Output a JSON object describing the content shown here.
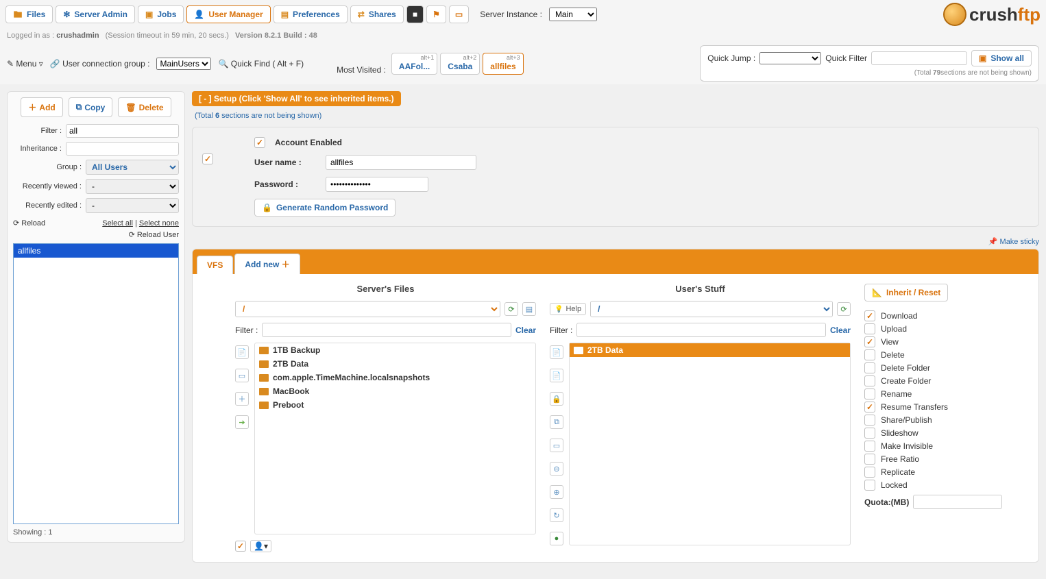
{
  "topnav": {
    "files": "Files",
    "server_admin": "Server Admin",
    "jobs": "Jobs",
    "user_manager": "User Manager",
    "preferences": "Preferences",
    "shares": "Shares",
    "server_instance_label": "Server Instance :",
    "server_instance_value": "Main"
  },
  "logo": {
    "part1": "crush",
    "part2": "ftp"
  },
  "info": {
    "logged_in_as_label": "Logged in as :",
    "user": "crushadmin",
    "timeout": "(Session timeout in 59 min, 20 secs.)",
    "version": "Version 8.2.1 Build : 48"
  },
  "toolbar2": {
    "menu": "Menu",
    "conn_group_label": "User connection group :",
    "conn_group_value": "MainUsers",
    "quick_find": "Quick Find ( Alt + F)",
    "most_visited": "Most Visited :",
    "tabs": [
      {
        "alt": "alt+1",
        "label": "AAFol..."
      },
      {
        "alt": "alt+2",
        "label": "Csaba"
      },
      {
        "alt": "alt+3",
        "label": "allfiles"
      }
    ],
    "quick_jump": "Quick Jump :",
    "quick_filter": "Quick Filter",
    "show_all": "Show all",
    "note_a": "(Total ",
    "note_b": "79",
    "note_c": "sections are not being shown)"
  },
  "sidebar": {
    "add": "Add",
    "copy": "Copy",
    "delete": "Delete",
    "filter_label": "Filter :",
    "filter_value": "all",
    "inheritance_label": "Inheritance :",
    "group_label": "Group :",
    "group_value": "All Users",
    "recently_viewed": "Recently viewed :",
    "recently_viewed_value": "-",
    "recently_edited": "Recently edited :",
    "recently_edited_value": "-",
    "reload": "Reload",
    "select_all": "Select all",
    "select_none": "Select none",
    "reload_user": "Reload User",
    "users": [
      "allfiles"
    ],
    "showing_label": "Showing :",
    "showing_count": "1"
  },
  "setup": {
    "header": "[ - ] Setup (Click 'Show All' to see inherited items.)",
    "note_a": "(Total ",
    "note_b": "6",
    "note_c": " sections are not being shown)"
  },
  "account": {
    "enabled_label": "Account Enabled",
    "username_label": "User name :",
    "username_value": "allfiles",
    "password_label": "Password :",
    "password_value": "••••••••••••••",
    "gen_btn": "Generate Random Password"
  },
  "sticky": "Make sticky",
  "vfs": {
    "tab_vfs": "VFS",
    "tab_addnew": "Add new",
    "server_files_title": "Server's Files",
    "user_stuff_title": "User's Stuff",
    "server_path": "/",
    "user_path": "/",
    "help": "Help",
    "filter_label": "Filter :",
    "clear": "Clear",
    "server_files": [
      "1TB Backup",
      "2TB Data",
      "com.apple.TimeMachine.localsnapshots",
      "MacBook",
      "Preboot"
    ],
    "user_files": [
      "2TB Data"
    ],
    "inherit_reset": "Inherit / Reset",
    "perms": [
      {
        "label": "Download",
        "checked": true
      },
      {
        "label": "Upload",
        "checked": false
      },
      {
        "label": "View",
        "checked": true
      },
      {
        "label": "Delete",
        "checked": false
      },
      {
        "label": "Delete Folder",
        "checked": false
      },
      {
        "label": "Create Folder",
        "checked": false
      },
      {
        "label": "Rename",
        "checked": false
      },
      {
        "label": "Resume Transfers",
        "checked": true
      },
      {
        "label": "Share/Publish",
        "checked": false
      },
      {
        "label": "Slideshow",
        "checked": false
      },
      {
        "label": "Make Invisible",
        "checked": false
      },
      {
        "label": "Free Ratio",
        "checked": false
      },
      {
        "label": "Replicate",
        "checked": false
      },
      {
        "label": "Locked",
        "checked": false
      }
    ],
    "quota_label": "Quota:(MB)"
  }
}
